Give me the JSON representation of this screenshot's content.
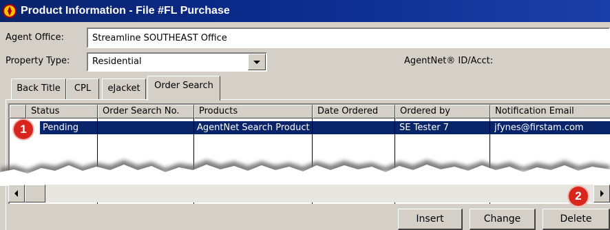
{
  "window": {
    "title": "Product Information - File #FL Purchase",
    "icon": "app-logo-icon"
  },
  "form": {
    "agent_office_label": "Agent Office:",
    "agent_office_value": "Streamline SOUTHEAST Office",
    "property_type_label": "Property Type:",
    "property_type_value": "Residential",
    "agentnet_label": "AgentNet® ID/Acct:"
  },
  "tabs": [
    {
      "label": "Back Title"
    },
    {
      "label": "CPL"
    },
    {
      "label": "eJacket"
    },
    {
      "label": "Order Search",
      "active": true
    }
  ],
  "grid": {
    "columns": [
      "Status",
      "Order Search No.",
      "Products",
      "Date Ordered",
      "Ordered by",
      "Notification Email"
    ],
    "rows": [
      {
        "Status": "Pending",
        "Order Search No.": "",
        "Products": "AgentNet Search Products",
        "Date Ordered": "",
        "Ordered by": "SE Tester 7",
        "Notification Email": "jfynes@firstam.com",
        "selected": true
      }
    ]
  },
  "annotations": [
    "1",
    "2"
  ],
  "buttons": {
    "insert": "Insert",
    "change": "Change",
    "delete": "Delete"
  },
  "colors": {
    "title_bar": "#0a246a",
    "selection": "#0a246a",
    "window_bg": "#d4d0c8",
    "badge": "#d9261c"
  }
}
